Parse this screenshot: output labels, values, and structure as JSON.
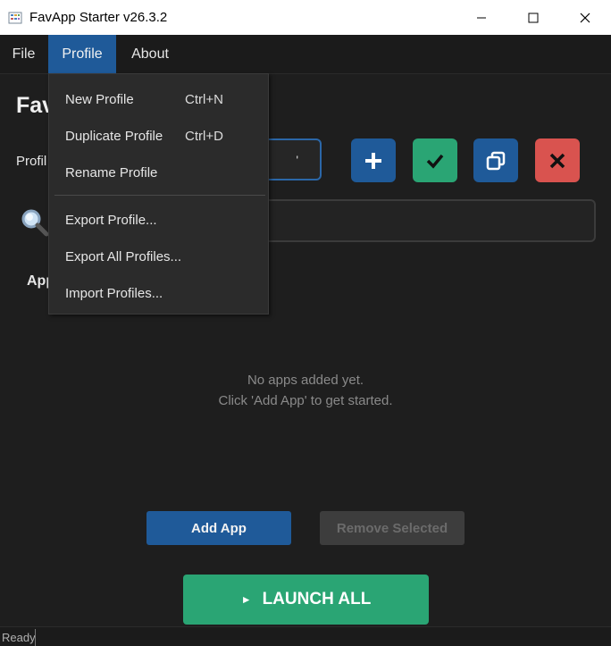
{
  "window": {
    "title": "FavApp Starter v26.3.2",
    "controls": [
      "minimize",
      "maximize",
      "close"
    ]
  },
  "menubar": {
    "items": [
      {
        "label": "File",
        "active": false
      },
      {
        "label": "Profile",
        "active": true
      },
      {
        "label": "About",
        "active": false
      }
    ]
  },
  "main": {
    "heading": "Fav",
    "profile_label": "Profil",
    "profile_select_value": "'",
    "apps_heading": "App",
    "empty_line1": "No apps added yet.",
    "empty_line2": "Click 'Add App' to get started.",
    "add_app_label": "Add App",
    "remove_selected_label": "Remove Selected",
    "launch_all_label": "LAUNCH ALL"
  },
  "profile_actions": [
    {
      "icon": "plus-icon",
      "color": "#1f5a99"
    },
    {
      "icon": "checkmark-icon",
      "color": "#2aa574"
    },
    {
      "icon": "copy-icon",
      "color": "#1f5a99"
    },
    {
      "icon": "x-icon",
      "color": "#d9534f"
    }
  ],
  "profile_menu": {
    "items": [
      {
        "label": "New Profile",
        "shortcut": "Ctrl+N"
      },
      {
        "label": "Duplicate Profile",
        "shortcut": "Ctrl+D"
      },
      {
        "label": "Rename Profile",
        "shortcut": ""
      },
      {
        "label": "Export Profile...",
        "shortcut": ""
      },
      {
        "label": "Export All Profiles...",
        "shortcut": ""
      },
      {
        "label": "Import Profiles...",
        "shortcut": ""
      }
    ]
  },
  "status": {
    "text": "Ready"
  },
  "colors": {
    "accent": "#1f5a99",
    "success": "#2aa574",
    "danger": "#d9534f",
    "background": "#1e1e1e"
  }
}
